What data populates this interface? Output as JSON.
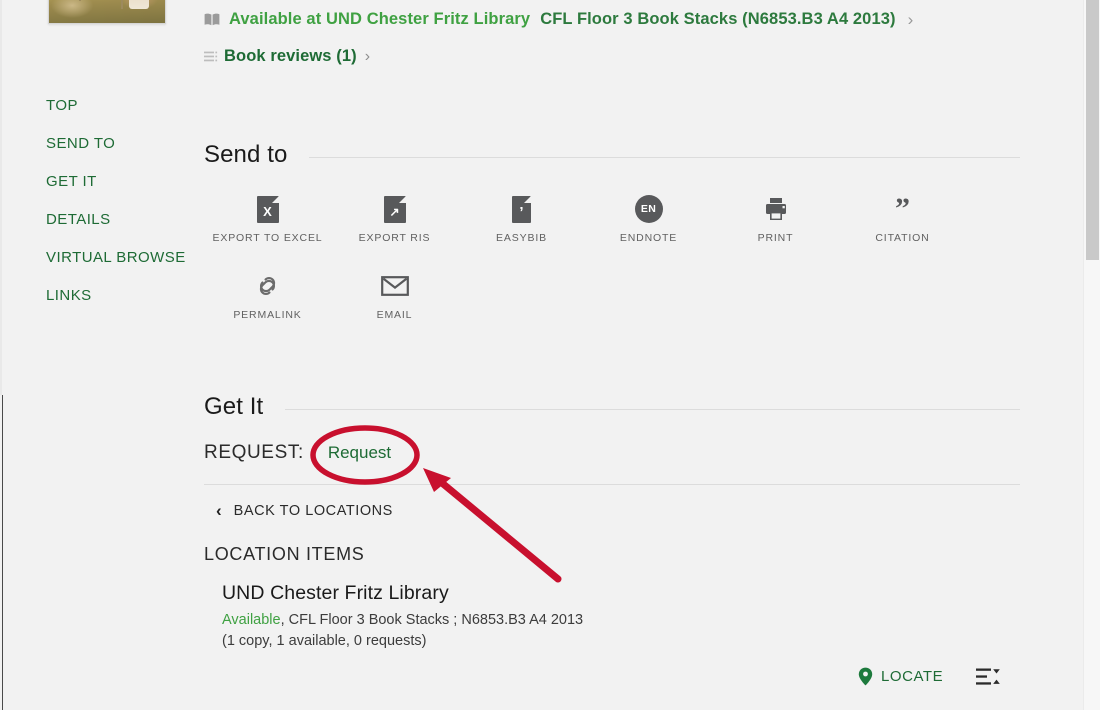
{
  "availability": {
    "icon": "open-book-icon",
    "status_text": "Available at UND Chester Fritz Library",
    "location_text": "CFL Floor 3 Book Stacks (N6853.B3 A4 2013)",
    "chevron": "›"
  },
  "reviews": {
    "icon": "list-lines-icon",
    "label": "Book reviews (1)",
    "chevron": "›"
  },
  "sidebar": {
    "items": [
      {
        "label": "TOP"
      },
      {
        "label": "SEND TO"
      },
      {
        "label": "GET IT"
      },
      {
        "label": "DETAILS"
      },
      {
        "label": "VIRTUAL BROWSE"
      },
      {
        "label": "LINKS"
      }
    ]
  },
  "send_to": {
    "title": "Send to",
    "actions": [
      {
        "label": "EXPORT TO EXCEL",
        "icon": "excel-document-icon",
        "glyph": "X"
      },
      {
        "label": "EXPORT RIS",
        "icon": "export-ris-document-icon",
        "glyph": "↗"
      },
      {
        "label": "EASYBIB",
        "icon": "easybib-document-icon",
        "glyph": "’"
      },
      {
        "label": "ENDNOTE",
        "icon": "endnote-circle-icon",
        "glyph": "EN"
      },
      {
        "label": "PRINT",
        "icon": "printer-icon",
        "glyph": ""
      },
      {
        "label": "CITATION",
        "icon": "quotation-mark-icon",
        "glyph": "”"
      },
      {
        "label": "PERMALINK",
        "icon": "chain-link-icon",
        "glyph": ""
      },
      {
        "label": "EMAIL",
        "icon": "envelope-icon",
        "glyph": ""
      }
    ]
  },
  "get_it": {
    "title": "Get It",
    "request_label": "REQUEST:",
    "request_link": "Request",
    "back_to_locations": "BACK TO LOCATIONS",
    "back_chevron": "‹",
    "location_items_title": "LOCATION ITEMS",
    "location": {
      "name": "UND Chester Fritz Library",
      "availability": "Available",
      "details": ", CFL Floor 3 Book Stacks ; N6853.B3 A4 2013",
      "copies": "(1 copy, 1 available, 0 requests)"
    },
    "locate_label": "LOCATE",
    "locate_icon": "map-pin-icon",
    "sort_icon": "sort-lines-icon"
  },
  "colors": {
    "brand_green": "#1e6b35",
    "available_green": "#3fa142",
    "annotation_red": "#c8102e",
    "page_background": "#f2f2f2",
    "icon_grey": "#58595b"
  },
  "annotation": {
    "shape": "ellipse-highlight-with-arrow",
    "target": "Request"
  }
}
